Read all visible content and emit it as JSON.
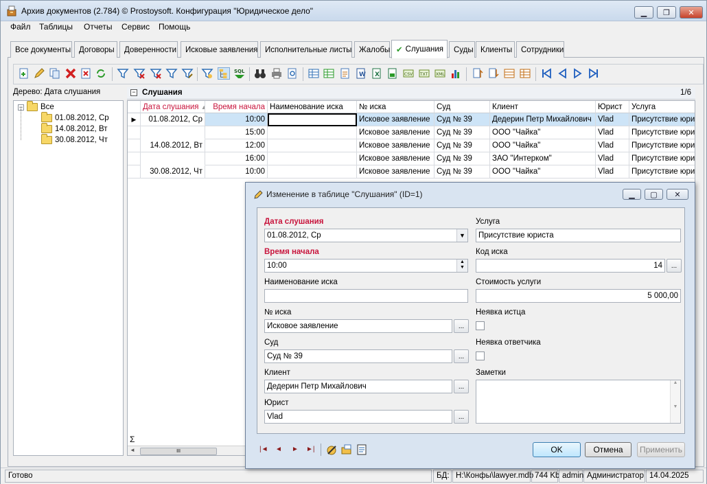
{
  "window": {
    "title": "Архив документов (2.784) © Prostoysoft. Конфигурация \"Юридическое дело\""
  },
  "menu": [
    "Файл",
    "Таблицы",
    "Отчеты",
    "Сервис",
    "Помощь"
  ],
  "tabs": [
    "Все документы",
    "Договоры",
    "Доверенности",
    "Исковые заявления",
    "Исполнительные листы",
    "Жалобы",
    "Слушания",
    "Суды",
    "Клиенты",
    "Сотрудники"
  ],
  "active_tab_check": "✔",
  "tree": {
    "header": "Дерево: Дата слушания",
    "root": "Все",
    "items": [
      "01.08.2012, Ср",
      "14.08.2012, Вт",
      "30.08.2012, Чт"
    ]
  },
  "grid": {
    "title": "Слушания",
    "counter": "1/6",
    "sum_symbol": "Σ",
    "scroll_grip": "III",
    "columns": [
      "Дата слушания",
      "Время начала",
      "Наименование иска",
      "№ иска",
      "Суд",
      "Клиент",
      "Юрист",
      "Услуга"
    ],
    "rows": [
      [
        "01.08.2012, Ср",
        "10:00",
        "",
        "Исковое заявление",
        "Суд № 39",
        "Дедерин Петр Михайлович",
        "Vlad",
        "Присутствие юриста"
      ],
      [
        "",
        "15:00",
        "",
        "Исковое заявление",
        "Суд № 39",
        "ООО \"Чайка\"",
        "Vlad",
        "Присутствие юриста"
      ],
      [
        "14.08.2012, Вт",
        "12:00",
        "",
        "Исковое заявление",
        "Суд № 39",
        "ООО \"Чайка\"",
        "Vlad",
        "Присутствие юриста"
      ],
      [
        "",
        "16:00",
        "",
        "Исковое заявление",
        "Суд № 39",
        "ЗАО \"Интерком\"",
        "Vlad",
        "Присутствие юриста"
      ],
      [
        "30.08.2012, Чт",
        "10:00",
        "",
        "Исковое заявление",
        "Суд № 39",
        "ООО \"Чайка\"",
        "Vlad",
        "Присутствие юриста"
      ]
    ]
  },
  "dialog": {
    "title": "Изменение в таблице \"Слушания\" (ID=1)",
    "left": {
      "date_label": "Дата слушания",
      "date_value": "01.08.2012, Ср",
      "time_label": "Время начала",
      "time_value": "10:00",
      "suit_name_label": "Наименование иска",
      "suit_name_value": "",
      "suit_no_label": "№ иска",
      "suit_no_value": "Исковое заявление",
      "court_label": "Суд",
      "court_value": "Суд № 39",
      "client_label": "Клиент",
      "client_value": "Дедерин Петр Михайлович",
      "lawyer_label": "Юрист",
      "lawyer_value": "Vlad"
    },
    "right": {
      "service_label": "Услуга",
      "service_value": "Присутствие юриста",
      "code_label": "Код иска",
      "code_value": "14",
      "cost_label": "Стоимость услуги",
      "cost_value": "5 000,00",
      "plaintiff_absent_label": "Неявка истца",
      "plaintiff_absent": false,
      "defendant_absent_label": "Неявка ответчика",
      "defendant_absent": false,
      "notes_label": "Заметки",
      "notes_value": ""
    },
    "dots": "...",
    "buttons": {
      "ok": "OK",
      "cancel": "Отмена",
      "apply": "Применить"
    }
  },
  "status": {
    "ready": "Готово",
    "db_label": "БД:",
    "db_path": "H:\\Конфы\\lawyer.mdb",
    "size": "744 Kb",
    "user": "admin",
    "role": "Администратор",
    "date": "14.04.2025"
  },
  "colors": {
    "required": "#c8143c",
    "selected_row": "#cde4f7",
    "dialog_bg": "#d9e4f1"
  }
}
